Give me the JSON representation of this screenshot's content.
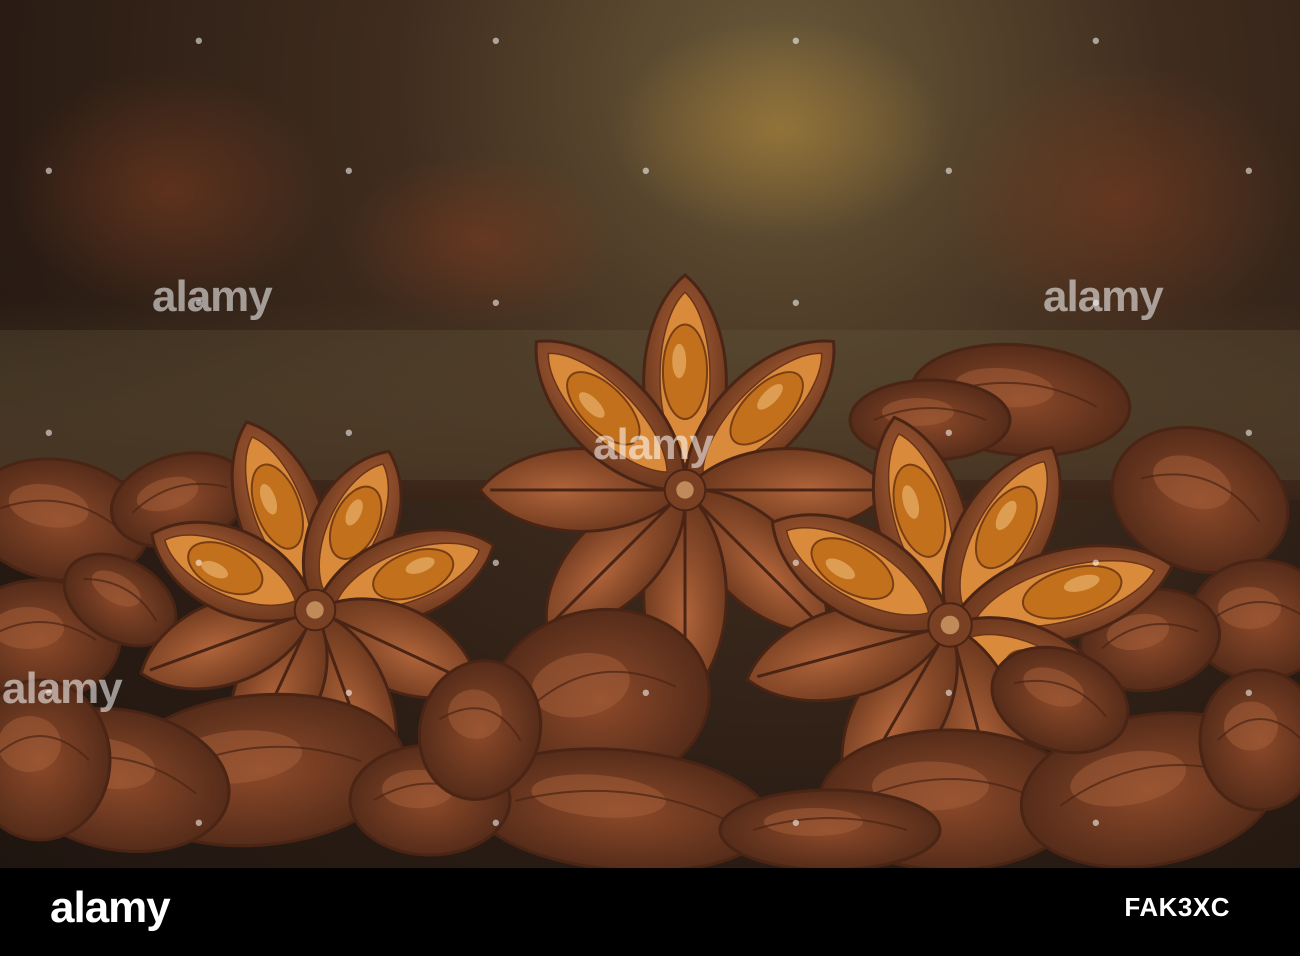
{
  "image": {
    "subject": "dried star anise pods close-up",
    "palette": {
      "pod": "#8a4a26",
      "pod_dark": "#4a2414",
      "seed": "#c2701c",
      "inner": "#d98a3a",
      "bg_dark": "#2a1c14",
      "bg_warm": "#6b5a3a"
    }
  },
  "watermark": {
    "text": "alamy"
  },
  "footer_bar": {
    "logo": "alamy",
    "image_id": "FAK3XC",
    "background": "#000000",
    "text_color": "#ffffff"
  }
}
